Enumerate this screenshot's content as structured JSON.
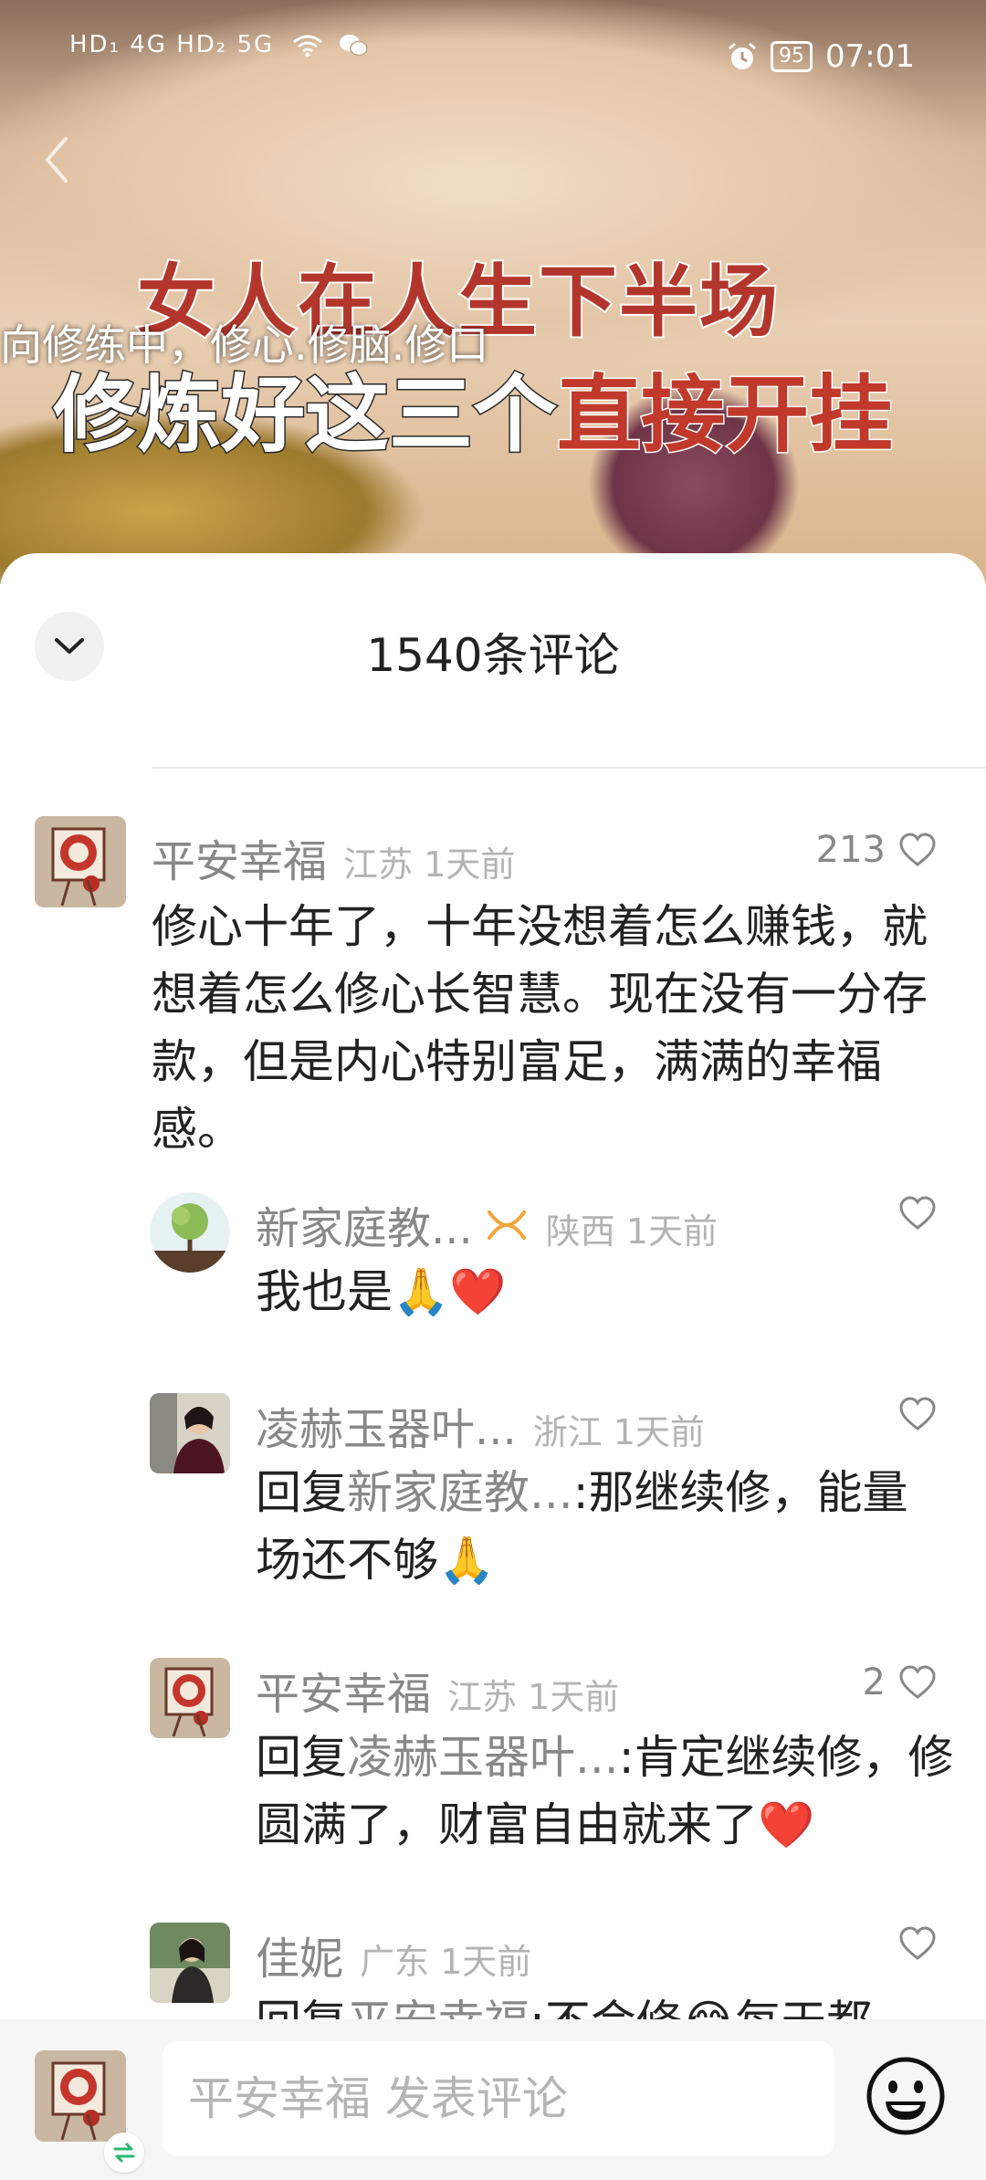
{
  "status_bar": {
    "network_left": "HD₁ 4G HD₂ 5G",
    "battery": "95",
    "time": "07:01"
  },
  "video": {
    "title_line1": "女人在人生下半场",
    "subtitle": "向修练中，修心.修脑.修口",
    "title_line2_a": "修炼好这三个",
    "title_line2_b": "直接开挂"
  },
  "comments_header": {
    "title": "1540条评论"
  },
  "comments": [
    {
      "name": "平安幸福",
      "meta": "江苏 1天前",
      "likes": "213",
      "text": "修心十年了，十年没想着怎么赚钱，就想着怎么修心长智慧。现在没有一分存款，但是内心特别富足，满满的幸福感。"
    }
  ],
  "replies": [
    {
      "name": "新家庭教...",
      "meta": "陕西 1天前",
      "likes": "",
      "text": "我也是🙏❤️"
    },
    {
      "name": "凌赫玉器叶...",
      "meta": "浙江 1天前",
      "likes": "",
      "reply_prefix": "回复",
      "reply_to": "新家庭教...",
      "text": ":那继续修，能量场还不够🙏"
    },
    {
      "name": "平安幸福",
      "meta": "江苏 1天前",
      "likes": "2",
      "reply_prefix": "回复",
      "reply_to": "凌赫玉器叶...",
      "text": ":肯定继续修，修圆满了，财富自由就来了❤️"
    },
    {
      "name": "佳妮",
      "meta": "广东 1天前",
      "likes": "",
      "reply_prefix": "回复",
      "reply_to": "平安幸福",
      "text": ":不会修😂每天都"
    }
  ],
  "composer": {
    "placeholder": "平安幸福 发表评论"
  },
  "colors": {
    "heart": "#ff3b57",
    "muted_text": "#888888",
    "main_text": "#222222"
  },
  "icons": [
    "back-arrow-icon",
    "alarm-icon",
    "wifi-icon",
    "wechat-icon",
    "chevron-down-icon",
    "heart-outline-icon",
    "creator-badge-icon",
    "swap-icon",
    "smiley-icon"
  ]
}
